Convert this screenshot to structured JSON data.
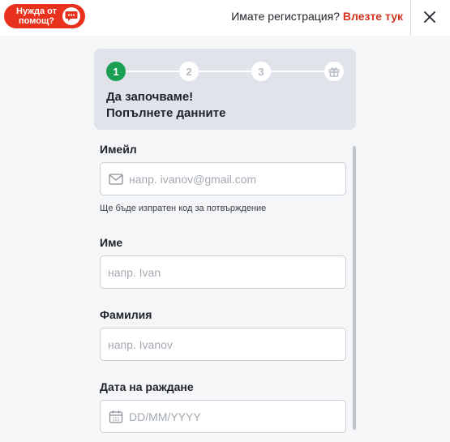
{
  "header": {
    "help_label": "Нужда от помощ?",
    "login_prompt": "Имате регистрация?",
    "login_link": "Влезте тук"
  },
  "steps": {
    "items": [
      "1",
      "2",
      "3"
    ],
    "final_icon": "gift-icon",
    "active_index": 0,
    "title_line1": "Да започваме!",
    "title_line2": "Попълнете данните"
  },
  "form": {
    "email": {
      "label": "Имейл",
      "placeholder": "напр. ivanov@gmail.com",
      "hint": "Ще бъде изпратен код за потвърждение",
      "icon": "envelope-icon"
    },
    "first_name": {
      "label": "Име",
      "placeholder": "напр. Ivan"
    },
    "last_name": {
      "label": "Фамилия",
      "placeholder": "напр. Ivanov"
    },
    "birth_date": {
      "label": "Дата на раждане",
      "placeholder": "DD/MM/YYYY",
      "icon": "calendar-icon"
    }
  },
  "colors": {
    "brand_red": "#e8321e",
    "link_red": "#d6321f",
    "step_active": "#1ba053",
    "card_bg": "#e0e4ea"
  }
}
